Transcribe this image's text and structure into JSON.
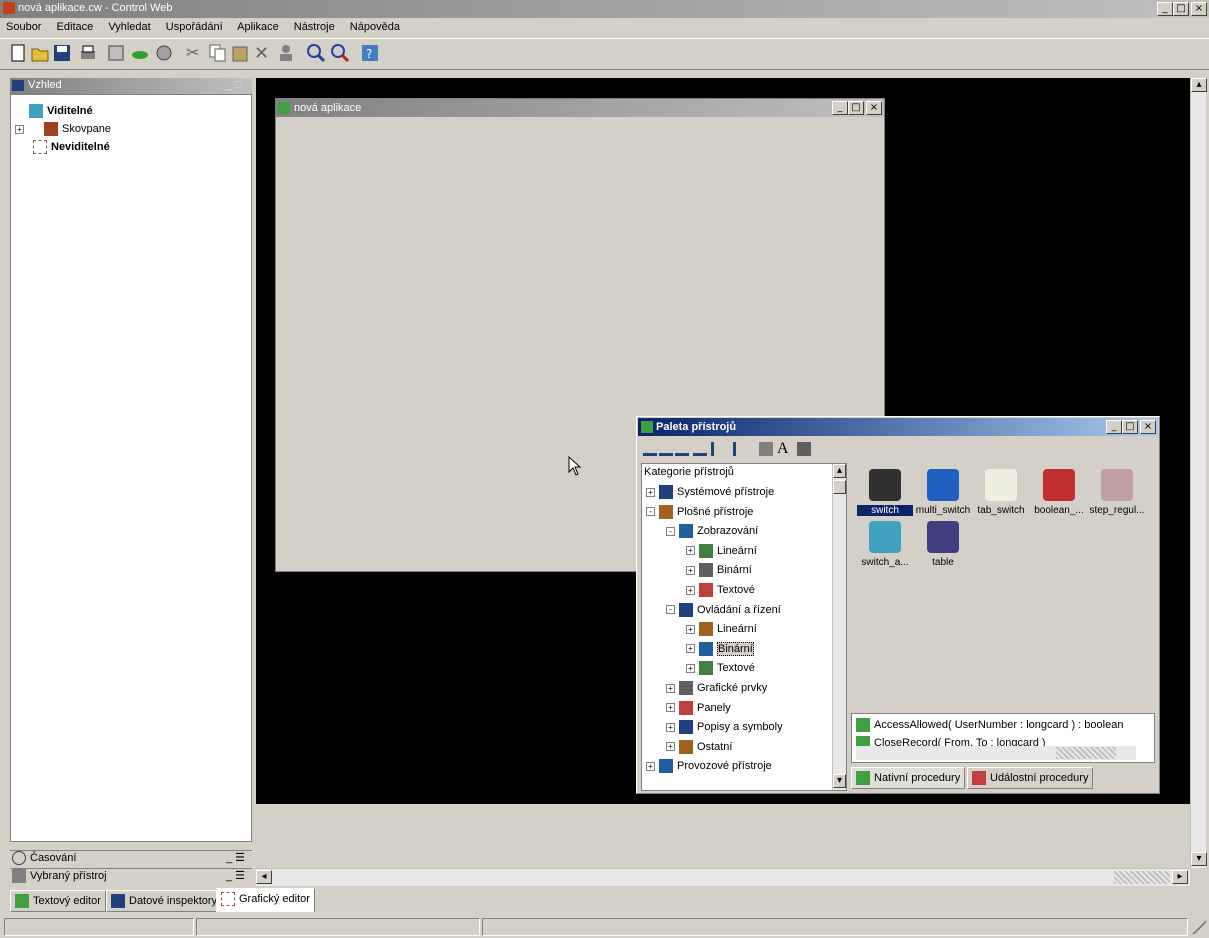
{
  "app": {
    "title": "nová aplikace.cw - Control Web",
    "win_min": "_",
    "win_max": "□",
    "win_close": "×"
  },
  "menu": [
    "Soubor",
    "Editace",
    "Vyhledat",
    "Uspořádání",
    "Aplikace",
    "Nástroje",
    "Nápověda"
  ],
  "toolbar_icons": [
    "new-file-icon",
    "open-folder-icon",
    "save-icon",
    "print-icon",
    "properties-icon",
    "cloud-icon",
    "globe-icon",
    "cut-icon",
    "copy-icon",
    "paste-icon",
    "delete-icon",
    "user-icon",
    "zoom-in-icon",
    "zoom-out-icon",
    "help-icon"
  ],
  "left_panel": {
    "title": "Vzhled",
    "tree": [
      {
        "label": "Viditelné",
        "bold": true
      },
      {
        "label": "Skovpane",
        "bold": false
      },
      {
        "label": "Neviditelné",
        "bold": true
      }
    ],
    "bottom_items": [
      {
        "label": "Časování",
        "icon": "clock-icon"
      },
      {
        "label": "Vybraný přístroj",
        "icon": "device-icon"
      }
    ]
  },
  "app_window": {
    "title": "nová aplikace"
  },
  "palette": {
    "title": "Paleta přístrojů",
    "tree_header": "Kategorie přístrojů",
    "tree": [
      {
        "label": "Systémové přístroje",
        "level": 0,
        "pm": "+"
      },
      {
        "label": "Plošné přístroje",
        "level": 0,
        "pm": "-"
      },
      {
        "label": "Zobrazování",
        "level": 1,
        "pm": "-"
      },
      {
        "label": "Lineární",
        "level": 2,
        "pm": "+"
      },
      {
        "label": "Binární",
        "level": 2,
        "pm": "+"
      },
      {
        "label": "Textové",
        "level": 2,
        "pm": "+"
      },
      {
        "label": "Ovládání a řízení",
        "level": 1,
        "pm": "-"
      },
      {
        "label": "Lineární",
        "level": 2,
        "pm": "+"
      },
      {
        "label": "Binární",
        "level": 2,
        "pm": "+",
        "selected": true
      },
      {
        "label": "Textové",
        "level": 2,
        "pm": "+"
      },
      {
        "label": "Grafické prvky",
        "level": 1,
        "pm": "+"
      },
      {
        "label": "Panely",
        "level": 1,
        "pm": "+"
      },
      {
        "label": "Popisy a symboly",
        "level": 1,
        "pm": "+"
      },
      {
        "label": "Ostatní",
        "level": 1,
        "pm": "+"
      },
      {
        "label": "Provozové přístroje",
        "level": 0,
        "pm": "+"
      }
    ],
    "gallery": [
      {
        "label": "switch",
        "selected": true
      },
      {
        "label": "multi_switch",
        "selected": false
      },
      {
        "label": "tab_switch",
        "selected": false
      },
      {
        "label": "boolean_...",
        "selected": false
      },
      {
        "label": "step_regul...",
        "selected": false
      },
      {
        "label": "switch_a...",
        "selected": false
      },
      {
        "label": "table",
        "selected": false
      }
    ],
    "procedures": [
      "AccessAllowed( UserNumber : longcard ) : boolean",
      "CloseRecord( From, To : longcard )"
    ],
    "tabs": [
      "Nativní procedury",
      "Událostní procedury"
    ]
  },
  "bottom_tabs": [
    "Textový editor",
    "Datové inspektory",
    "Grafický editor"
  ],
  "active_bottom_tab": 2
}
